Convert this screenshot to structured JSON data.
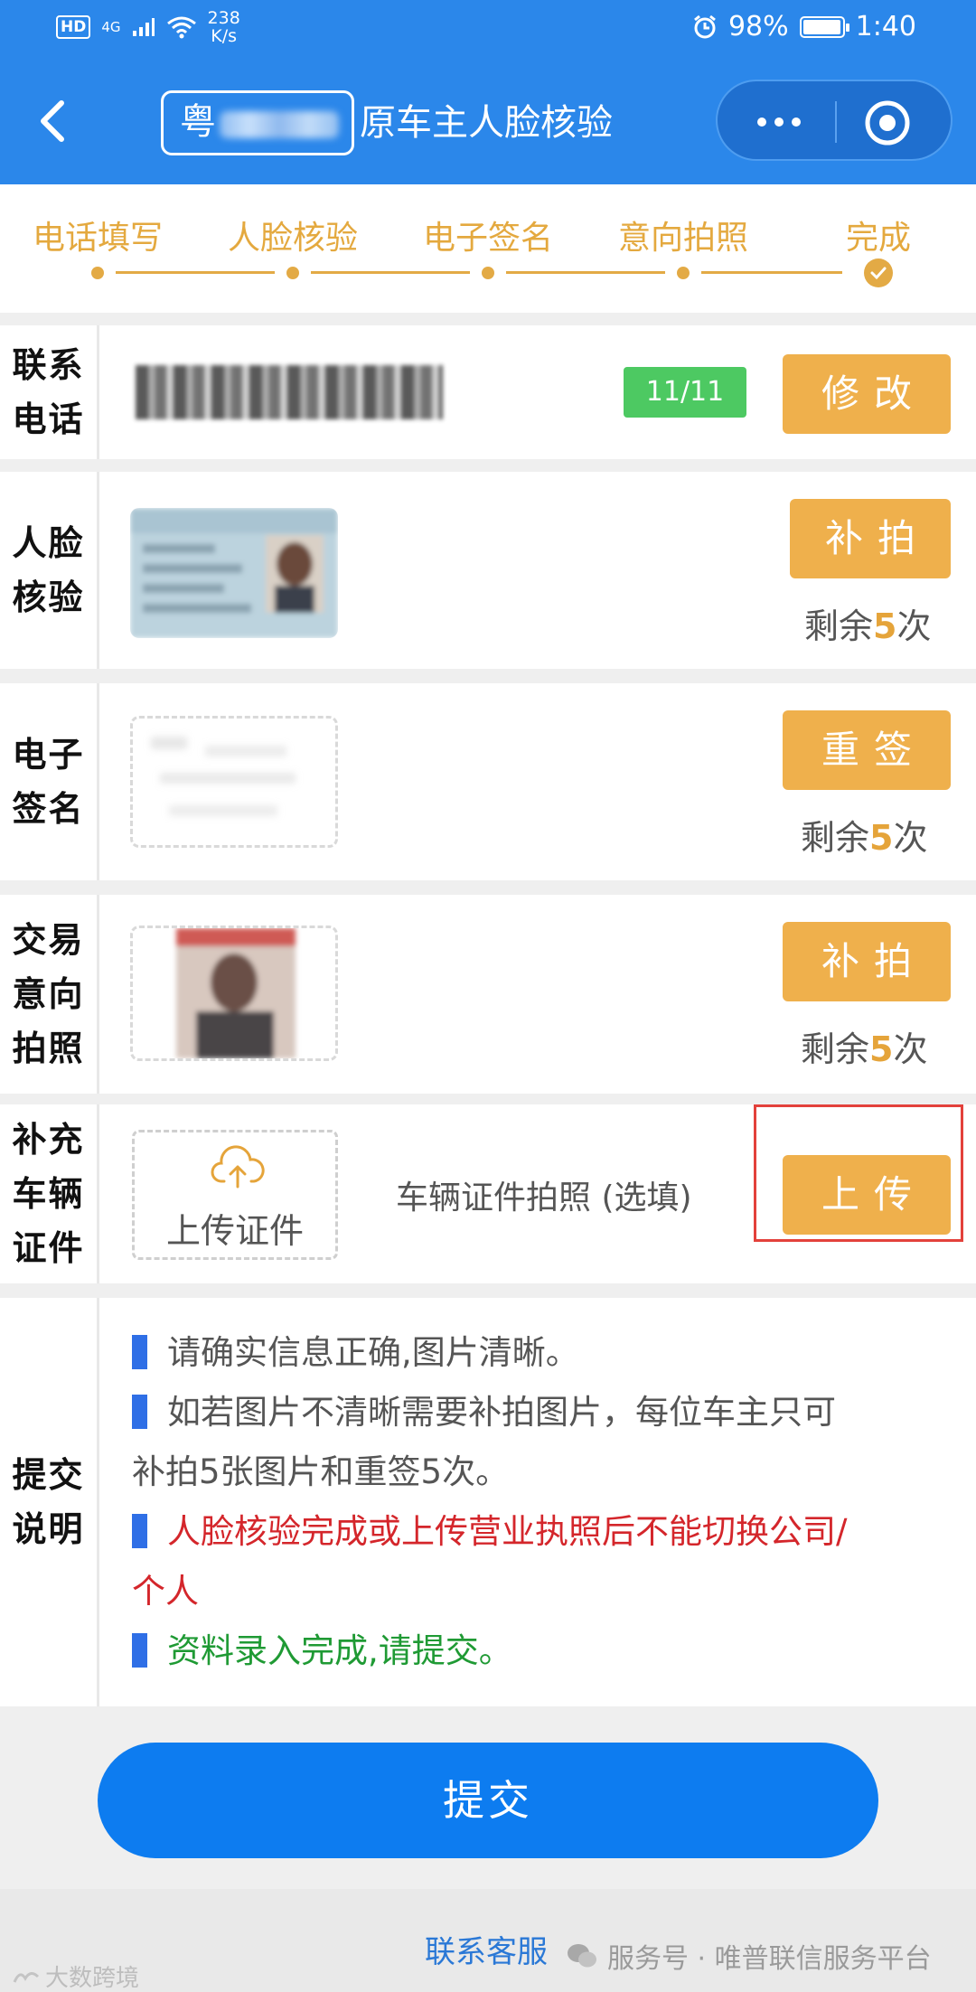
{
  "status_bar": {
    "hd": "HD",
    "network": "4G",
    "speed_value": "238",
    "speed_unit": "K/s",
    "battery_percent": "98%",
    "battery_level": 0.98,
    "time": "1:40"
  },
  "nav": {
    "plate_prefix": "粤",
    "title": "原车主人脸核验"
  },
  "steps": [
    "电话填写",
    "人脸核验",
    "电子签名",
    "意向拍照",
    "完成"
  ],
  "rows": {
    "phone": {
      "label": "联系电话",
      "counter": "11/11",
      "button": "修改"
    },
    "face": {
      "label": "人脸核验",
      "button": "补拍",
      "remain_prefix": "剩余",
      "remain_count": "5",
      "remain_suffix": "次"
    },
    "signature": {
      "label": "电子签名",
      "button": "重签",
      "remain_prefix": "剩余",
      "remain_count": "5",
      "remain_suffix": "次"
    },
    "intent_photo": {
      "label": "交易意向拍照",
      "button": "补拍",
      "remain_prefix": "剩余",
      "remain_count": "5",
      "remain_suffix": "次"
    },
    "vehicle_docs": {
      "label": "补充车辆证件",
      "upload_text": "上传证件",
      "description": "车辆证件拍照 (选填)",
      "button": "上传"
    }
  },
  "instructions": {
    "label": "提交说明",
    "line1": "请确实信息正确,图片清晰。",
    "line2a": "如若图片不清晰需要补拍图片，每位车主只可",
    "line2b": "补拍5张图片和重签5次。",
    "line3a": "人脸核验完成或上传营业执照后不能切换公司/",
    "line3b": "个人",
    "line4": "资料录入完成,请提交。"
  },
  "submit_label": "提交",
  "footer": {
    "contact": "联系客服",
    "watermark_right": "服务号 · 唯普联信服务平台",
    "watermark_left": "大数跨境"
  },
  "colors": {
    "header_blue": "#2b87ea",
    "accent_orange": "#efb04c",
    "submit_blue": "#0d7cf0",
    "counter_green": "#4dc962",
    "warning_red": "#d4262b",
    "ok_green": "#1f9a34"
  },
  "icons": [
    "back-arrow-icon",
    "more-dots-icon",
    "close-circle-icon",
    "checkmark-icon",
    "cloud-upload-icon",
    "wechat-icon"
  ]
}
